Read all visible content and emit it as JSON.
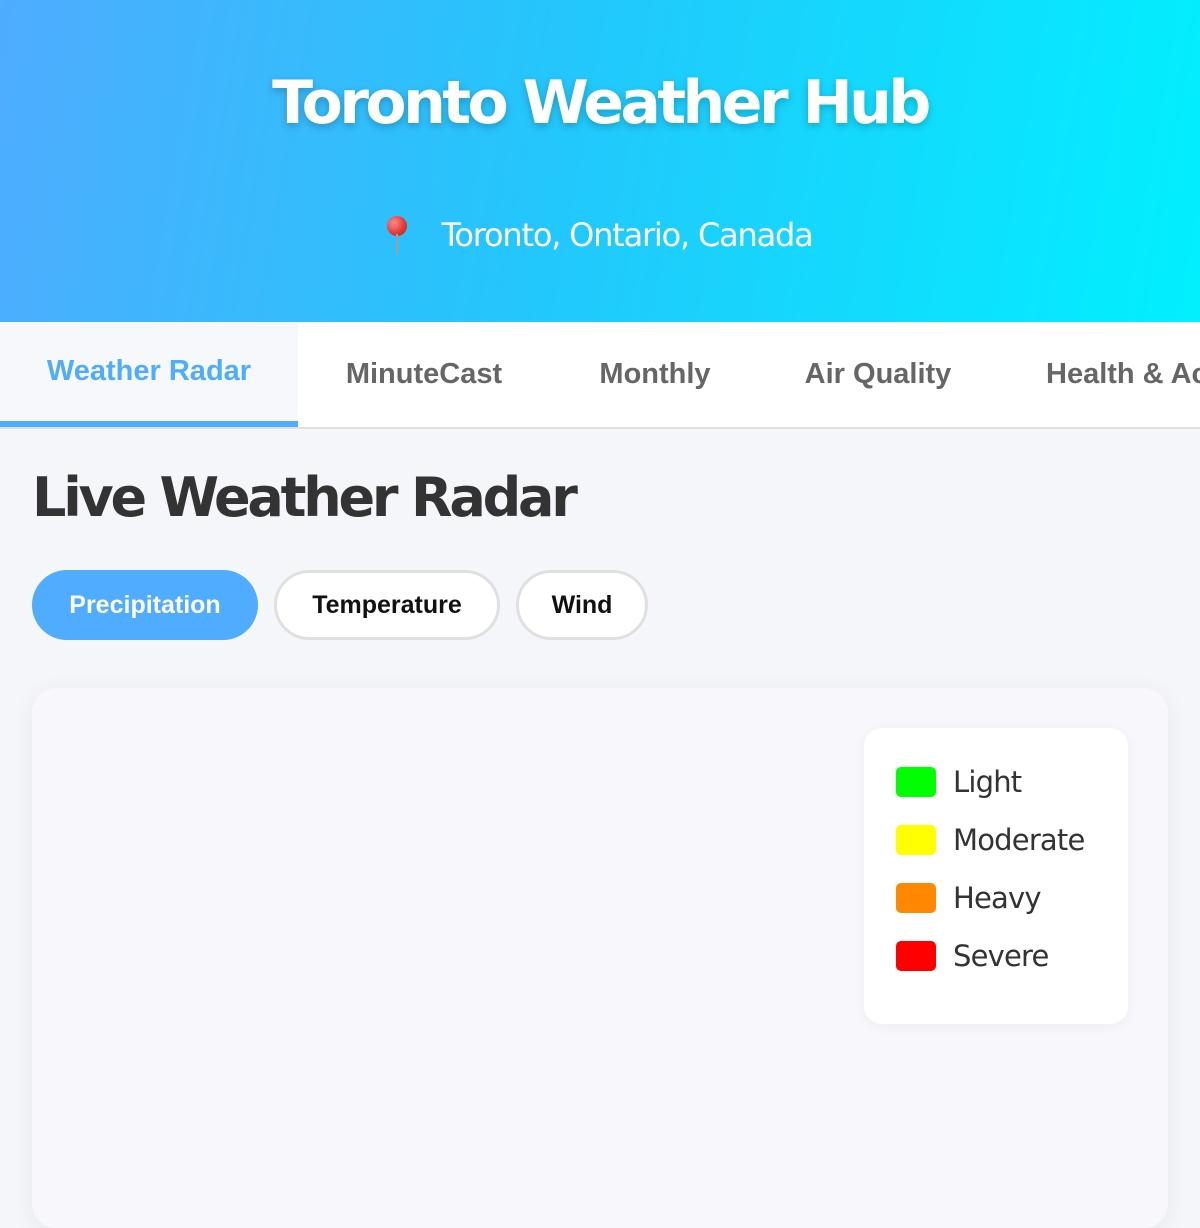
{
  "header": {
    "title": "Toronto Weather Hub",
    "location": "Toronto, Ontario, Canada",
    "location_icon": "map-pin-icon"
  },
  "tabs": [
    {
      "label": "Weather Radar",
      "active": true
    },
    {
      "label": "MinuteCast",
      "active": false
    },
    {
      "label": "Monthly",
      "active": false
    },
    {
      "label": "Air Quality",
      "active": false
    },
    {
      "label": "Health & Activities",
      "active": false
    }
  ],
  "radar": {
    "title": "Live Weather Radar",
    "layers": [
      {
        "label": "Precipitation",
        "active": true
      },
      {
        "label": "Temperature",
        "active": false
      },
      {
        "label": "Wind",
        "active": false
      }
    ],
    "legend": [
      {
        "label": "Light",
        "color": "#00ff00"
      },
      {
        "label": "Moderate",
        "color": "#ffff00"
      },
      {
        "label": "Heavy",
        "color": "#ff8800"
      },
      {
        "label": "Severe",
        "color": "#ff0000"
      }
    ]
  },
  "colors": {
    "accent": "#4facfe",
    "header_gradient_start": "#4facfe",
    "header_gradient_end": "#00f2fe",
    "text_dark": "#333333",
    "text_muted": "#666666"
  }
}
